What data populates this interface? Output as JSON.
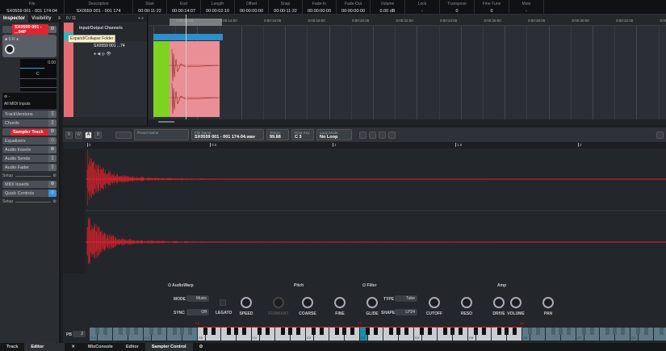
{
  "infoline": [
    {
      "label": "File",
      "value": "SX0559  001 - 001 174-04",
      "w": 80
    },
    {
      "label": "Description",
      "value": "SX0559  001 - 001 174",
      "w": 85
    },
    {
      "label": "Start",
      "value": "00:00:11:22",
      "w": 42
    },
    {
      "label": "End",
      "value": "00:00:14:07",
      "w": 42
    },
    {
      "label": "Length",
      "value": "00:00:02:10",
      "w": 42
    },
    {
      "label": "Offset",
      "value": "00:00:00:00",
      "w": 42
    },
    {
      "label": "Snap",
      "value": "00:00:11:22",
      "w": 42
    },
    {
      "label": "Fade-In",
      "value": "00:00:00:00",
      "w": 42
    },
    {
      "label": "Fade-Out",
      "value": "00:00:00:00",
      "w": 42
    },
    {
      "label": "Volume",
      "value": "0.00 dB",
      "w": 43
    },
    {
      "label": "Lock",
      "value": "-",
      "w": 43
    },
    {
      "label": "Transpose",
      "value": "0",
      "w": 43
    },
    {
      "label": "Fine-Tune",
      "value": "0",
      "w": 43
    },
    {
      "label": "Mute",
      "value": "-",
      "w": 43
    }
  ],
  "inspector": {
    "tabs": [
      "Inspector",
      "Visibility"
    ],
    "track_name": "SX0559  001 - ...04P",
    "volume_value": "0.00",
    "pan_value": "C",
    "midi_input": "All MIDI Inputs",
    "sections": [
      "TrackVersions",
      "Chords"
    ],
    "sampler_track": "Sampler Track",
    "sections2": [
      "Equalizers",
      "Audio Inserts",
      "Audio Sends",
      "Audio Fader"
    ],
    "setup": "Setup",
    "sections3": [
      "MIDI Inserts",
      "Quick Controls"
    ],
    "setup2": "Setup"
  },
  "tracklist": {
    "count": "0 / 11",
    "folder": "Input/Output Channels",
    "tooltip": "Expand/Collapse Folder",
    "track": "SX0559  001 ...74"
  },
  "ruler": [
    "0:00:12:00",
    "0:00:14:00",
    "0:00:16:00",
    "0:00:18:00",
    "0:00:20:00",
    "0:00:22:00",
    "0:00:24:00",
    "0:00:26:00",
    "0:00:28:00",
    "0:00:30:00",
    "0:00:32:00",
    "0:00:3"
  ],
  "sampler": {
    "rw": [
      "R",
      "W"
    ],
    "ab": [
      "A",
      "B"
    ],
    "preset_label": "Preset Name",
    "file_label": "File Name",
    "file_name": "SX0559  001 - 001 174-04.wav",
    "tempo_label": "Tempo",
    "tempo": "99.88",
    "rootkey_label": "Root Key",
    "rootkey": "C 3",
    "loop_label": "Loop Mode",
    "loop": "No Loop",
    "ruler": [
      "0",
      "0.5",
      "1",
      "1.5",
      "2"
    ],
    "sections": [
      "AudioWarp",
      "Pitch",
      "Filter",
      "Amp"
    ],
    "mode_label": "MODE",
    "mode": "Music",
    "sync_label": "SYNC",
    "sync": "Off",
    "legato": "LEGATO",
    "knobs_warp": [
      "SPEED",
      "FORMANT"
    ],
    "knobs_pitch": [
      "COARSE",
      "FINE",
      "GLIDE"
    ],
    "type_label": "TYPE",
    "type": "Tube",
    "shape_label": "SHAPE",
    "shape": "LP24",
    "knobs_filter": [
      "CUTOFF",
      "RESO",
      "DRIVE"
    ],
    "knobs_amp": [
      "VOLUME",
      "PAN"
    ],
    "pb_label": "PB",
    "pb": "2",
    "key_labels": [
      "C-2",
      "C-1",
      "C0",
      "C1",
      "C2",
      "C3",
      "C4",
      "C5",
      "C6",
      "C7",
      "C8"
    ],
    "range_labels": [
      "C0",
      "C3",
      "C6"
    ]
  },
  "bottom_tabs": {
    "left": [
      "Track",
      "Editor"
    ],
    "right": [
      "MixConsole",
      "Editor",
      "Sampler Control"
    ]
  },
  "colors": {
    "red": "#e0242f",
    "track": "#e66c73",
    "blue": "#2c8fcc",
    "green": "#7ed321",
    "wave": "#e8212c"
  }
}
